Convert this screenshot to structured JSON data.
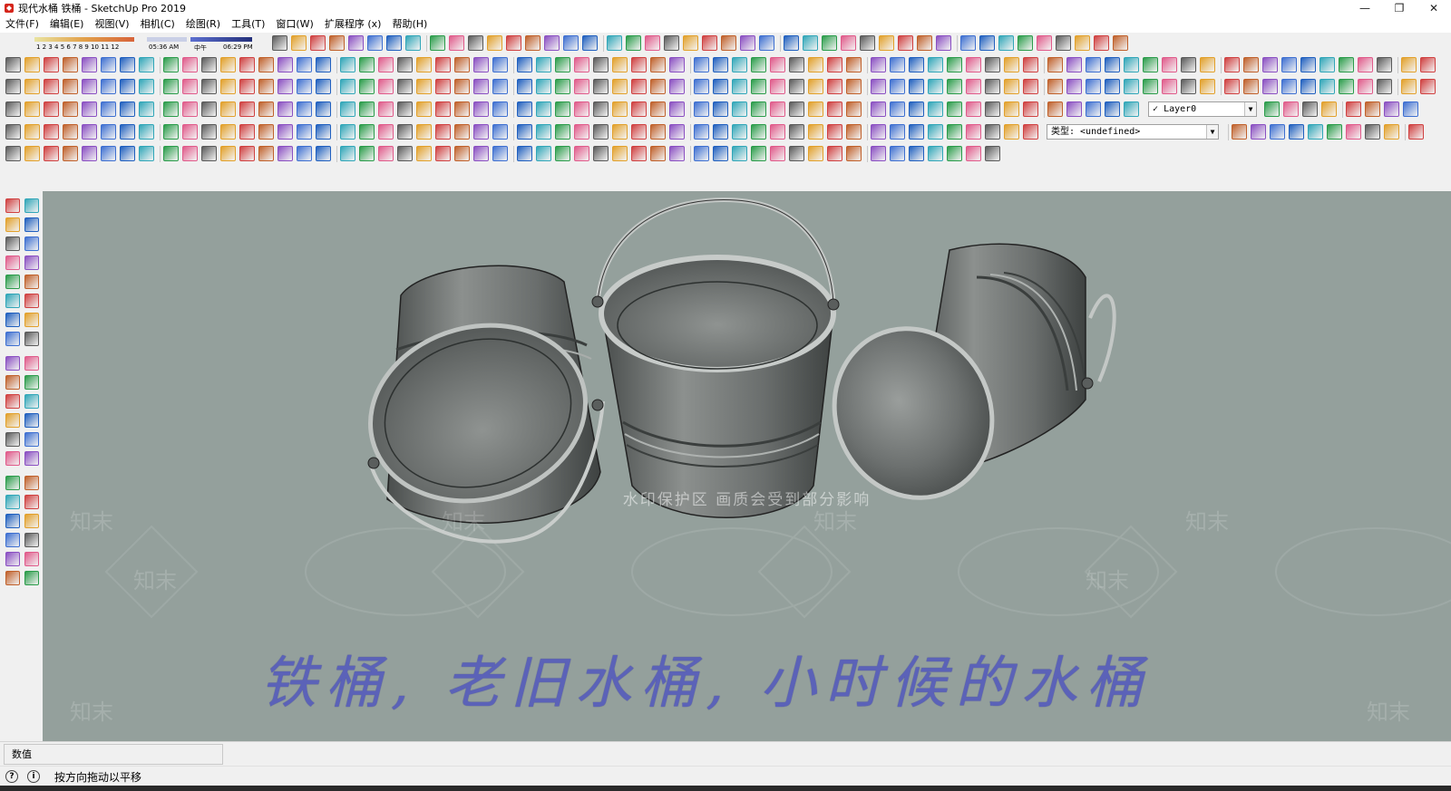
{
  "window": {
    "title": "现代水桶 铁桶 - SketchUp Pro 2019",
    "controls": {
      "minimize": "—",
      "maximize": "❐",
      "close": "✕"
    }
  },
  "menu": [
    "文件(F)",
    "编辑(E)",
    "视图(V)",
    "相机(C)",
    "绘图(R)",
    "工具(T)",
    "窗口(W)",
    "扩展程序 (x)",
    "帮助(H)"
  ],
  "shadow_timeline": {
    "months": "1 2 3 4 5 6 7 8 9 10 11 12",
    "time_start": "05:36 AM",
    "noon": "中午",
    "time_end": "06:29 PM"
  },
  "layer_dropdown": {
    "check": "✓",
    "value": "Layer0"
  },
  "type_dropdown": {
    "value": "类型: <undefined>"
  },
  "viewport": {
    "caption": "铁桶, 老旧水桶, 小时候的水桶",
    "watermark_notice": "水印保护区  画质会受到部分影响",
    "watermark_logo": "知末"
  },
  "measurements": {
    "label": "数值"
  },
  "status": {
    "message": "按方向拖动以平移"
  },
  "colors": {
    "viewport_bg": "#94a09c",
    "caption": "#5b62b8",
    "bucket_metal": "#6f7372",
    "bucket_rim": "#b9bdbb"
  }
}
